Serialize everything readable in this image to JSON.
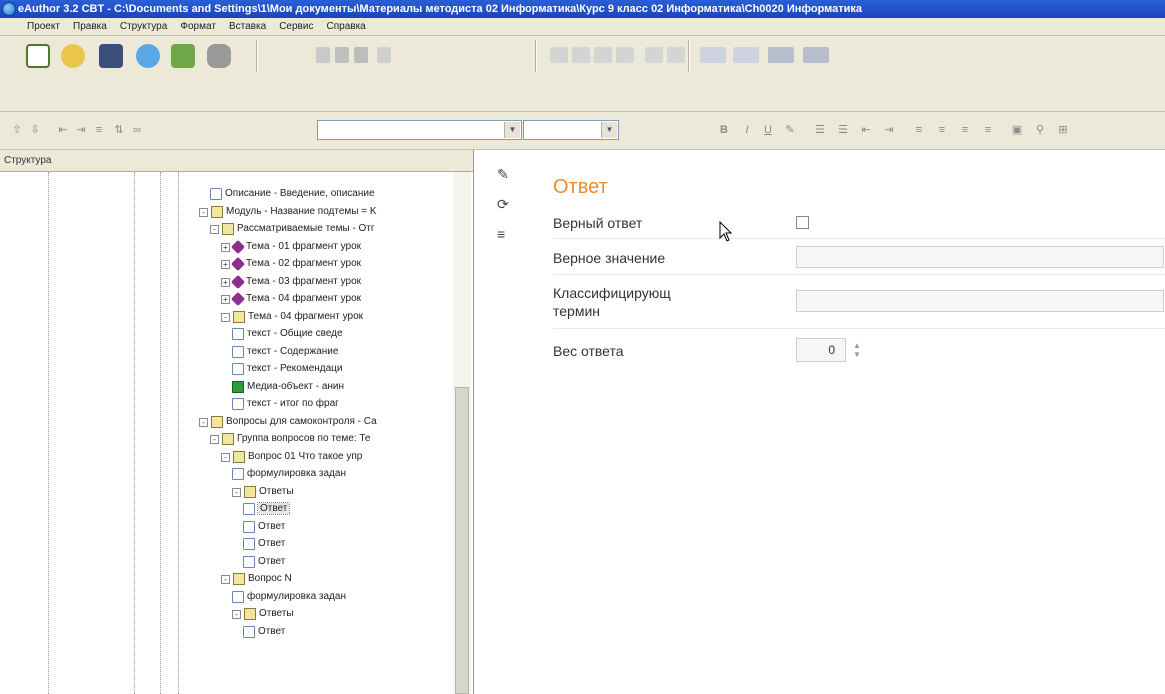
{
  "window": {
    "title": "eAuthor 3.2 CBT - C:\\Documents and Settings\\1\\Мои документы\\Материалы методиста 02 Информатика\\Курс 9 класс 02 Информатика\\Ch0020 Информатика"
  },
  "menu": [
    "Проект",
    "Правка",
    "Структура",
    "Формат",
    "Вставка",
    "Сервис",
    "Справка"
  ],
  "toolbar2": {
    "font_combo_value": "",
    "size_combo_value": ""
  },
  "left_panel": {
    "header": "Структура",
    "tree": [
      {
        "text": "Описание - Введение, описание",
        "icon": "doc",
        "level": 7
      },
      {
        "text": "Модуль - Название подтемы = K",
        "icon": "folder",
        "level": 6,
        "expander": "-"
      },
      {
        "text": "Рассматриваемые темы - Отг",
        "icon": "folder",
        "level": 7,
        "expander": "-"
      },
      {
        "text": "Тема - 01 фрагмент урок",
        "icon": "topic",
        "level": 8,
        "expander": "+"
      },
      {
        "text": "Тема - 02 фрагмент урок",
        "icon": "topic",
        "level": 8,
        "expander": "+"
      },
      {
        "text": "Тема - 03 фрагмент урок",
        "icon": "topic",
        "level": 8,
        "expander": "+"
      },
      {
        "text": "Тема - 04 фрагмент урок",
        "icon": "topic",
        "level": 8,
        "expander": "+"
      },
      {
        "text": "Тема - 04 фрагмент урок",
        "icon": "folder",
        "level": 8,
        "expander": "-"
      },
      {
        "text": "текст - Общие сведе",
        "icon": "doc",
        "level": 9
      },
      {
        "text": "текст - Содержание",
        "icon": "doc",
        "level": 9
      },
      {
        "text": "текст - Рекомендаци",
        "icon": "doc",
        "level": 9
      },
      {
        "text": "Медиа-объект - анин",
        "icon": "media",
        "level": 9
      },
      {
        "text": "текст - итог по фраг",
        "icon": "doc",
        "level": 9
      },
      {
        "text": "Вопросы для самоконтроля - Са",
        "icon": "folder",
        "level": 6,
        "expander": "-"
      },
      {
        "text": "Группа вопросов по теме: Те",
        "icon": "folder",
        "level": 7,
        "expander": "-"
      },
      {
        "text": "Вопрос 01 Что такое упр",
        "icon": "folder",
        "level": 8,
        "expander": "-"
      },
      {
        "text": "формулировка задан",
        "icon": "doc",
        "level": 9
      },
      {
        "text": "Ответы",
        "icon": "folder",
        "level": 9,
        "expander": "-"
      },
      {
        "text": "Ответ",
        "icon": "doc",
        "level": 10,
        "selected": true
      },
      {
        "text": "Ответ",
        "icon": "doc",
        "level": 10
      },
      {
        "text": "Ответ",
        "icon": "doc",
        "level": 10
      },
      {
        "text": "Ответ",
        "icon": "doc",
        "level": 10
      },
      {
        "text": "Вопрос N",
        "icon": "folder",
        "level": 8,
        "expander": "-"
      },
      {
        "text": "формулировка задан",
        "icon": "doc",
        "level": 9
      },
      {
        "text": "Ответы",
        "icon": "folder",
        "level": 9,
        "expander": "-"
      },
      {
        "text": "Ответ",
        "icon": "doc",
        "level": 10
      }
    ]
  },
  "form": {
    "title": "Ответ",
    "fields": {
      "correct_answer_label": "Верный ответ",
      "correct_value_label": "Верное значение",
      "correct_value": "",
      "classifying_term_label": "Классифицирующ\nтермин",
      "classifying_term": "",
      "weight_label": "Вес ответа",
      "weight_value": "0"
    }
  },
  "colors": {
    "title_bar": "#1b45b8",
    "form_title": "#f08a2a",
    "panel_bg": "#ece9d8"
  }
}
